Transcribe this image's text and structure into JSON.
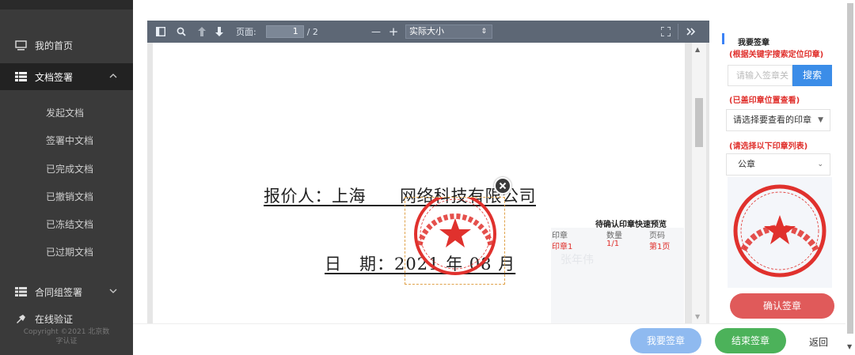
{
  "sidebar": {
    "items": [
      {
        "label": "我的首页",
        "icon": "monitor-icon"
      },
      {
        "label": "文档签署",
        "icon": "list-icon",
        "active": true
      },
      {
        "label": "合同组签署",
        "icon": "list-icon"
      },
      {
        "label": "在线验证",
        "icon": "verify-icon"
      }
    ],
    "subitems": [
      "发起文档",
      "签署中文档",
      "已完成文档",
      "已撤销文档",
      "已冻结文档",
      "已过期文档"
    ],
    "copyright": "Copyright ©2021 北京数",
    "copyright2": "字认证",
    "chevron_up": "⌃",
    "chevron_down": "⌄"
  },
  "toolbar": {
    "page_label": "页面:",
    "page_current": "1",
    "page_total": "/ 2",
    "zoom_value": "实际大小",
    "zoom_minus": "—",
    "zoom_plus": "+"
  },
  "document": {
    "line1": "报价人：上海　　网络科技有限公司",
    "line2": "日　期：2021 年 08 月"
  },
  "preview": {
    "title": "待确认印章快速预览",
    "headers": [
      "印章",
      "数量",
      "页码"
    ],
    "row": [
      "印章1",
      "1/1",
      "第1页"
    ],
    "ghost_text": "张年伟"
  },
  "right_panel": {
    "title": "我要签章",
    "hint_keyword": "(根据关键字搜索定位印章)",
    "search_placeholder": "请输入签章关",
    "search_button": "搜索",
    "hint_view": "(已盖印章位置查看)",
    "view_select": "请选择要查看的印章",
    "hint_list": "(请选择以下印章列表)",
    "seal_select": "公章",
    "confirm_button": "确认签章"
  },
  "bottom": {
    "sign_button": "我要签章",
    "end_button": "结束签章",
    "back_button": "返回"
  },
  "colors": {
    "accent_blue": "#3b8de8",
    "seal_red": "#e0312d",
    "success_green": "#4cb25a"
  }
}
